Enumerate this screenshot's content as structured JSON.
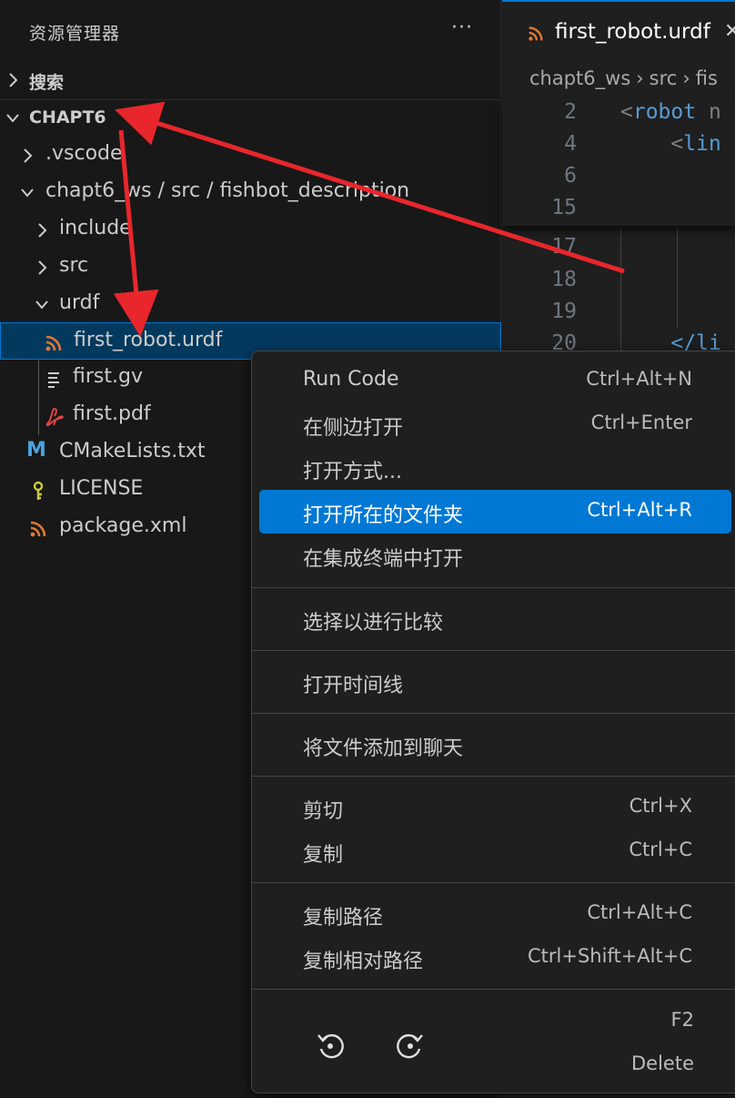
{
  "sidebar": {
    "title": "资源管理器",
    "more": "···",
    "search_section": "搜索",
    "workspace_section": "CHAPT6",
    "tree": [
      {
        "name": ".vscode",
        "icon": "chevron-right"
      },
      {
        "name": "chapt6_ws / src / fishbot_description",
        "icon": "chevron-down"
      },
      {
        "name": "include",
        "icon": "chevron-right"
      },
      {
        "name": "src",
        "icon": "chevron-right"
      },
      {
        "name": "urdf",
        "icon": "chevron-down"
      },
      {
        "name": "first_robot.urdf",
        "icon": "rss-icon"
      },
      {
        "name": "first.gv",
        "icon": "lines-icon"
      },
      {
        "name": "first.pdf",
        "icon": "pdf-icon"
      },
      {
        "name": "CMakeLists.txt",
        "icon": "cmake-icon"
      },
      {
        "name": "LICENSE",
        "icon": "license-icon"
      },
      {
        "name": "package.xml",
        "icon": "rss-icon"
      }
    ]
  },
  "editor": {
    "tab_title": "first_robot.urdf",
    "tab_close": "✕",
    "breadcrumb": [
      "chapt6_ws",
      "›",
      "src",
      "›",
      "fis"
    ],
    "sticky_lines": [
      {
        "ln": "2",
        "open": "<",
        "tag": "robot",
        "rest": " n"
      },
      {
        "ln": "4",
        "open": "    <",
        "tag": "lin",
        "rest": ""
      },
      {
        "ln": "6",
        "open": "",
        "tag": "",
        "rest": ""
      },
      {
        "ln": "15",
        "open": "",
        "tag": "",
        "rest": ""
      }
    ],
    "lines": [
      {
        "ln": "17",
        "text": ""
      },
      {
        "ln": "18",
        "text": ""
      },
      {
        "ln": "19",
        "text": ""
      },
      {
        "ln": "20",
        "text": "    </li"
      }
    ]
  },
  "context_menu": {
    "groups": [
      [
        {
          "label": "Run Code",
          "shortcut": "Ctrl+Alt+N"
        },
        {
          "label": "在侧边打开",
          "shortcut": "Ctrl+Enter"
        },
        {
          "label": "打开方式...",
          "shortcut": ""
        },
        {
          "label": "打开所在的文件夹",
          "shortcut": "Ctrl+Alt+R",
          "active": true
        },
        {
          "label": "在集成终端中打开",
          "shortcut": ""
        }
      ],
      [
        {
          "label": "选择以进行比较",
          "shortcut": ""
        }
      ],
      [
        {
          "label": "打开时间线",
          "shortcut": ""
        }
      ],
      [
        {
          "label": "将文件添加到聊天",
          "shortcut": ""
        }
      ],
      [
        {
          "label": "剪切",
          "shortcut": "Ctrl+X"
        },
        {
          "label": "复制",
          "shortcut": "Ctrl+C"
        }
      ],
      [
        {
          "label": "复制路径",
          "shortcut": "Ctrl+Alt+C"
        },
        {
          "label": "复制相对路径",
          "shortcut": "Ctrl+Shift+Alt+C"
        }
      ]
    ],
    "last_group": {
      "rename_shortcut": "F2",
      "delete_shortcut": "Delete"
    }
  },
  "colors": {
    "accent": "#0078d4",
    "rss": "#e37933",
    "pdf": "#e04444",
    "cmake": "#4aa3df",
    "license": "#cbcb41",
    "arrow": "#e8262c"
  }
}
